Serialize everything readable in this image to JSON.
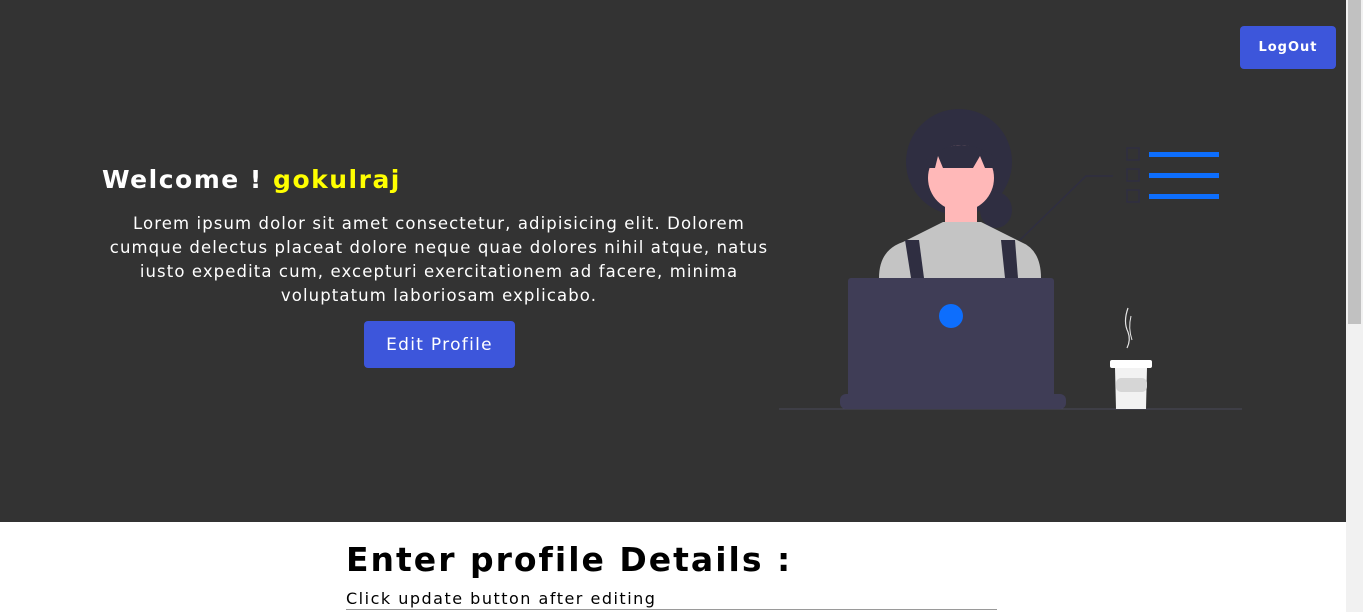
{
  "header": {
    "logout_label": "LogOut"
  },
  "hero": {
    "welcome_prefix": "Welcome !",
    "username": "gokulraj",
    "intro_text": "Lorem ipsum dolor sit amet consectetur, adipisicing elit. Dolorem cumque delectus placeat dolore neque quae dolores nihil atque, natus iusto expedita cum, excepturi exercitationem ad facere, minima voluptatum laboriosam explicabo.",
    "edit_profile_label": "Edit Profile"
  },
  "form": {
    "title": "Enter profile Details :",
    "subtitle": "Click update button after editing"
  },
  "colors": {
    "hero_background": "#333333",
    "button": "#3d56db",
    "username": "#ffff00",
    "illustration_accent": "#0d6efd"
  },
  "icons": {
    "illustration": "woman-at-laptop-illustration"
  }
}
